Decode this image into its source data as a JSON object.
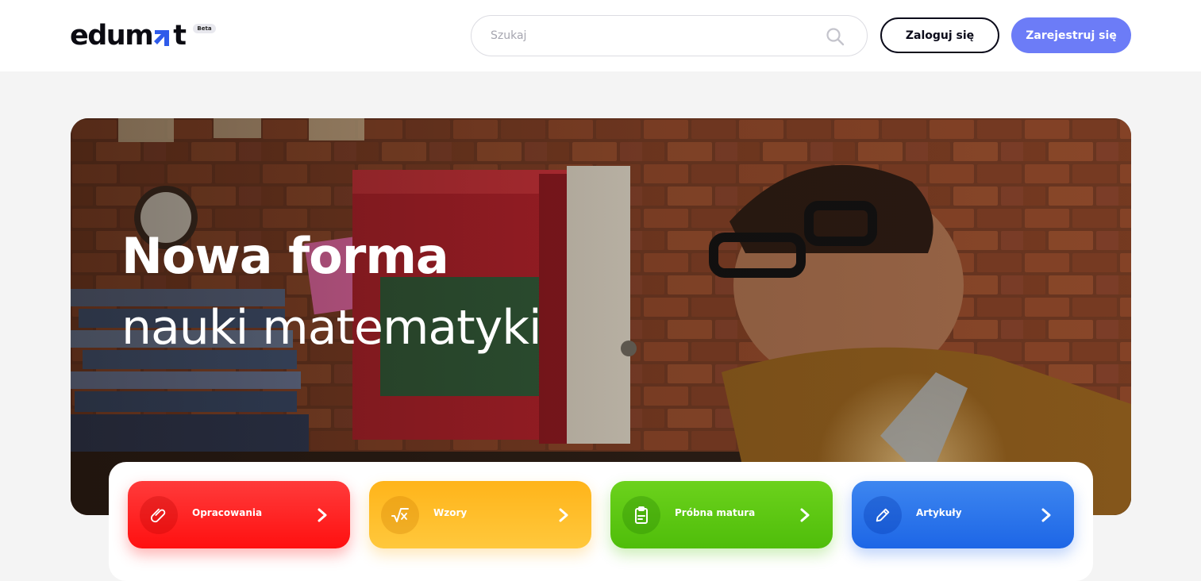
{
  "header": {
    "logo_text_1": "edum",
    "logo_text_2": "t",
    "logo_badge": "Beta",
    "search": {
      "placeholder": "Szukaj"
    },
    "login_label": "Zaloguj się",
    "register_label": "Zarejestruj się"
  },
  "hero": {
    "title_line_1": "Nowa forma",
    "title_line_2": "nauki matematyki"
  },
  "categories": [
    {
      "label": "Opracowania",
      "icon": "paperclip-icon",
      "color": "#ff1f1f"
    },
    {
      "label": "Wzory",
      "icon": "square-root-icon",
      "color": "#ffb41a"
    },
    {
      "label": "Próbna matura",
      "icon": "clipboard-icon",
      "color": "#5cc512"
    },
    {
      "label": "Artykuły",
      "icon": "pencil-icon",
      "color": "#2a74ea"
    }
  ],
  "colors": {
    "accent": "#6c7cf7",
    "logo_arrow": "#2f5bea",
    "text_dark": "#0b0b1a"
  }
}
